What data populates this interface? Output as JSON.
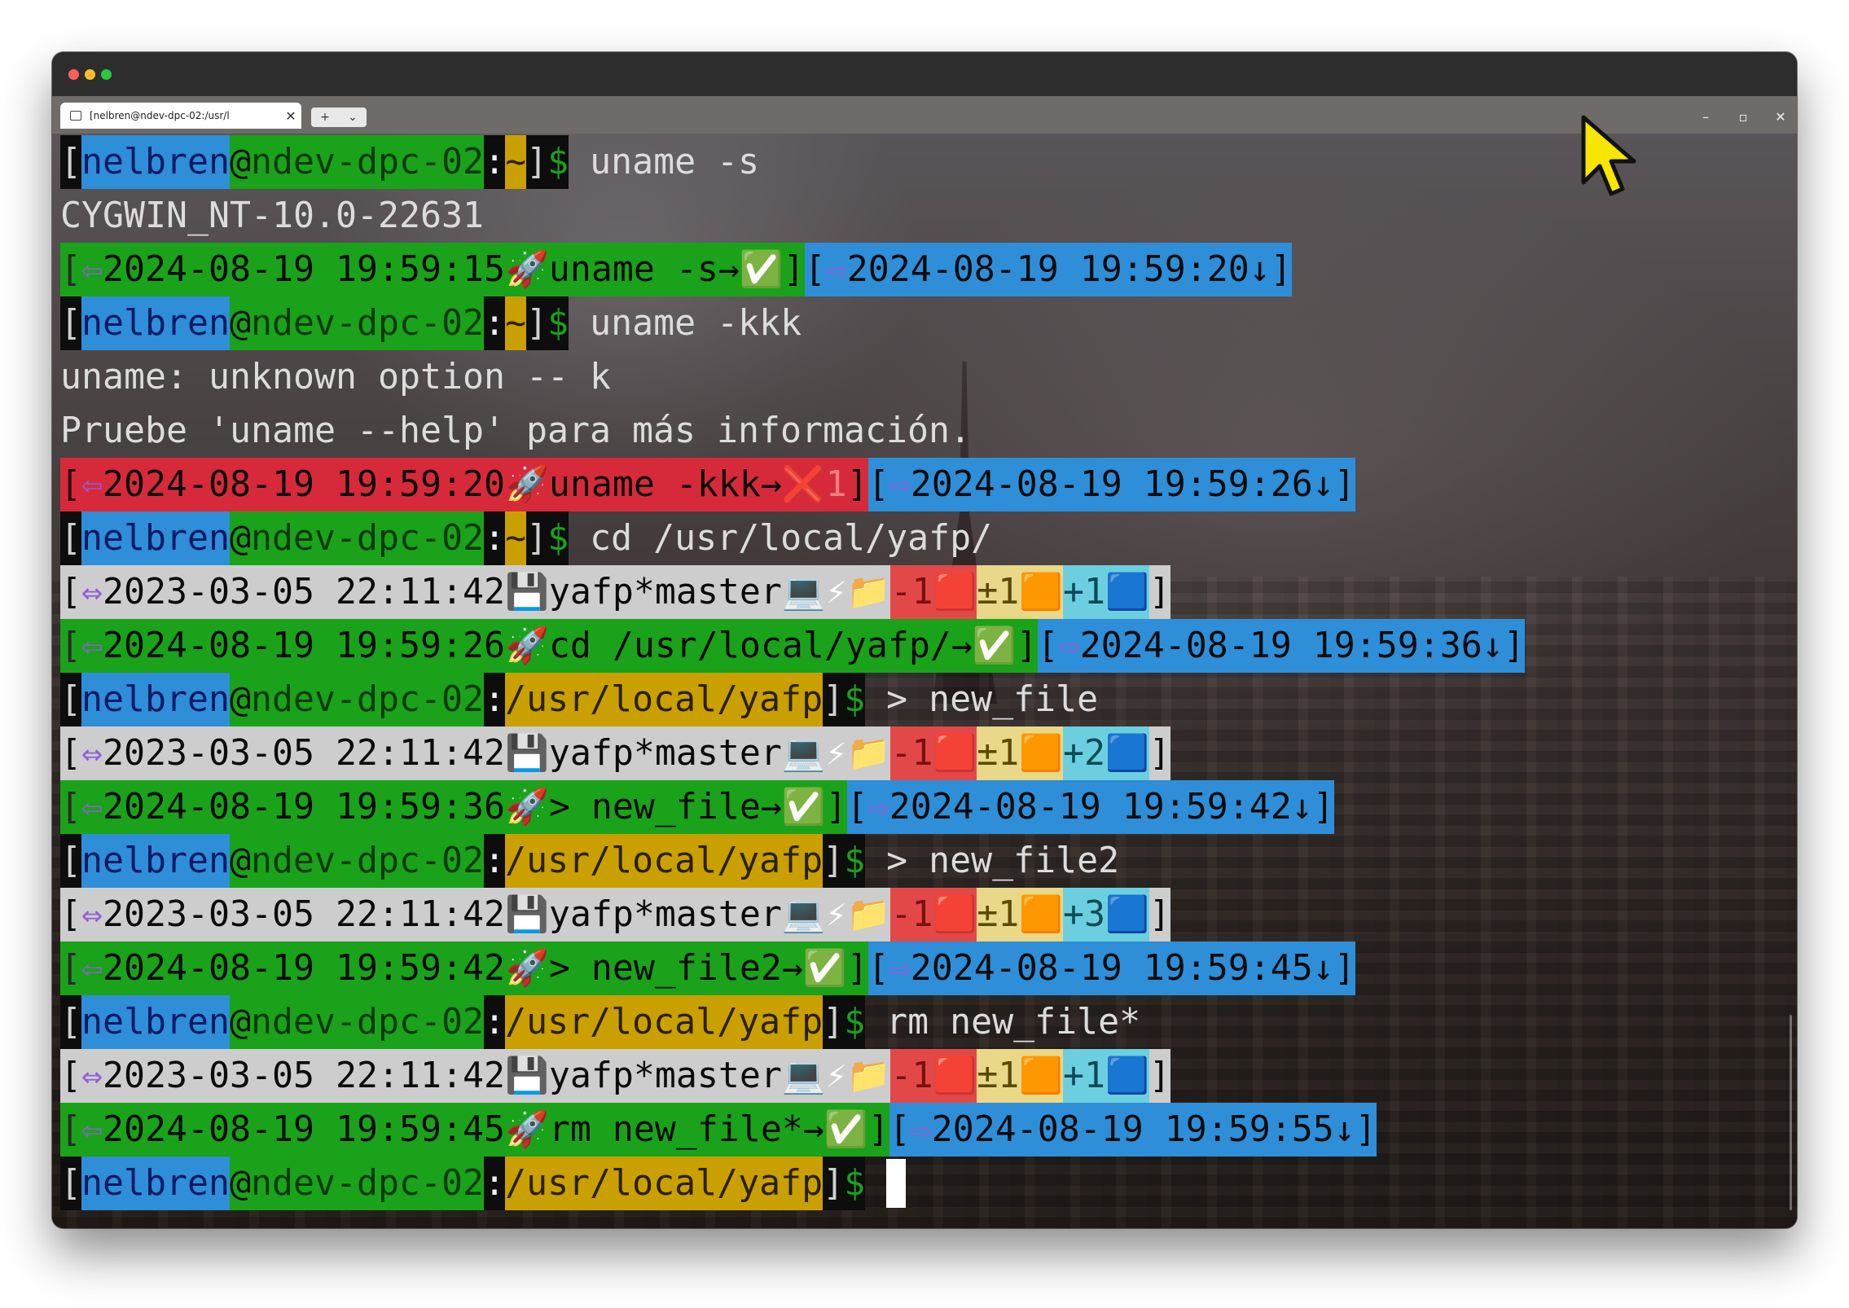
{
  "window": {
    "tab_title": "[nelbren@ndev-dpc-02:/usr/l",
    "tab_close": "✕",
    "new_tab": "+",
    "tab_menu": "⌄",
    "minimize": "–",
    "maximize": "▫",
    "close": "✕",
    "traffic_lights": [
      "#ff5f57",
      "#febc2e",
      "#28c840"
    ]
  },
  "colors": {
    "blue": "#2e8ed8",
    "green": "#1aa21a",
    "black": "#0d0d0d",
    "gold": "#c9a000",
    "red": "#d62a3a",
    "gray": "#cdcdcd",
    "sky": "#3a98dc",
    "yellow": "#e8d888",
    "cyan": "#6ccfe0",
    "lime": "#7dd87d",
    "lightred": "#e34848",
    "orange": "#f6a52c"
  },
  "terminal": {
    "lines": [
      {
        "segments": [
          [
            "[",
            "black",
            "#d0d0d0"
          ],
          [
            "nelbren",
            "blue",
            "#0e1a66"
          ],
          [
            "@",
            "green",
            "#101010"
          ],
          [
            "ndev-dpc-02",
            "green",
            "#0c3a0c"
          ],
          [
            ":",
            "black",
            "#f0f0f0"
          ],
          [
            "~",
            "gold",
            "#2a2000"
          ],
          [
            "]",
            "black",
            "#d0d0d0"
          ],
          [
            "$",
            "black",
            "#1ca01c"
          ],
          [
            " uname -s",
            "none",
            "#dcdcdc"
          ]
        ]
      },
      {
        "segments": [
          [
            "CYGWIN_NT-10.0-22631",
            "none",
            "#dcdcdc"
          ]
        ]
      },
      {
        "segments": [
          [
            "[",
            "green",
            "#2a2a2a"
          ],
          [
            "⇦",
            "green",
            "#8f5fd8"
          ],
          [
            "2024-08-19 19:59:15",
            "green",
            "#0b0b0b"
          ],
          [
            "🚀",
            "green",
            "#ffffff"
          ],
          [
            "uname -s→",
            "green",
            "#0b0b0b"
          ],
          [
            "✅",
            "green",
            "#ffffff"
          ],
          [
            "]",
            "green",
            "#0b0b0b"
          ],
          [
            "[",
            "blue",
            "#0b0b0b"
          ],
          [
            "⇨",
            "blue",
            "#8f5fd8"
          ],
          [
            "2024-08-19 19:59:20↓",
            "blue",
            "#0b0b0b"
          ],
          [
            "]",
            "blue",
            "#0b0b0b"
          ]
        ]
      },
      {
        "segments": [
          [
            "[",
            "black",
            "#d0d0d0"
          ],
          [
            "nelbren",
            "blue",
            "#0e1a66"
          ],
          [
            "@",
            "green",
            "#101010"
          ],
          [
            "ndev-dpc-02",
            "green",
            "#0c3a0c"
          ],
          [
            ":",
            "black",
            "#f0f0f0"
          ],
          [
            "~",
            "gold",
            "#2a2000"
          ],
          [
            "]",
            "black",
            "#d0d0d0"
          ],
          [
            "$",
            "black",
            "#1ca01c"
          ],
          [
            " uname -kkk",
            "none",
            "#dcdcdc"
          ]
        ]
      },
      {
        "segments": [
          [
            "uname: unknown option -- k",
            "none",
            "#dcdcdc"
          ]
        ]
      },
      {
        "segments": [
          [
            "Pruebe 'uname --help' para más información.",
            "none",
            "#dcdcdc"
          ]
        ]
      },
      {
        "segments": [
          [
            "[",
            "red",
            "#2a0a0a"
          ],
          [
            "⇦",
            "red",
            "#8f5fd8"
          ],
          [
            "2024-08-19 19:59:20",
            "red",
            "#0b0b0b"
          ],
          [
            "🚀",
            "red",
            "#ffffff"
          ],
          [
            "uname -kkk→",
            "red",
            "#0b0b0b"
          ],
          [
            "❌",
            "red",
            "#ffffff"
          ],
          [
            "1",
            "red",
            "#f08080"
          ],
          [
            "]",
            "red",
            "#0b0b0b"
          ],
          [
            "[",
            "blue",
            "#0b0b0b"
          ],
          [
            "⇨",
            "blue",
            "#8f5fd8"
          ],
          [
            "2024-08-19 19:59:26↓",
            "blue",
            "#0b0b0b"
          ],
          [
            "]",
            "blue",
            "#0b0b0b"
          ]
        ]
      },
      {
        "segments": [
          [
            "[",
            "black",
            "#d0d0d0"
          ],
          [
            "nelbren",
            "blue",
            "#0e1a66"
          ],
          [
            "@",
            "green",
            "#101010"
          ],
          [
            "ndev-dpc-02",
            "green",
            "#0c3a0c"
          ],
          [
            ":",
            "black",
            "#f0f0f0"
          ],
          [
            "~",
            "gold",
            "#2a2000"
          ],
          [
            "]",
            "black",
            "#d0d0d0"
          ],
          [
            "$",
            "black",
            "#1ca01c"
          ],
          [
            " cd /usr/local/yafp/",
            "none",
            "#dcdcdc"
          ]
        ]
      },
      {
        "segments": [
          [
            "[",
            "gray",
            "#0b0b0b"
          ],
          [
            "⇔",
            "gray",
            "#8f5fd8"
          ],
          [
            "2023-03-05 22:11:42",
            "gray",
            "#0b0b0b"
          ],
          [
            "💾",
            "gray",
            "#ffffff"
          ],
          [
            "yafp*master",
            "gray",
            "#0b0b0b"
          ],
          [
            "💻",
            "gray",
            "#ffffff"
          ],
          [
            "⚡",
            "gray",
            "#ffffff"
          ],
          [
            "📁",
            "gray",
            "#ffffff"
          ],
          [
            "-1",
            "lightred",
            "#7a1010"
          ],
          [
            "🟥",
            "lightred",
            "#ffffff"
          ],
          [
            "±1",
            "yellow",
            "#5a4a00"
          ],
          [
            "🟧",
            "yellow",
            "#ffffff"
          ],
          [
            "+1",
            "cyan",
            "#0a4a55"
          ],
          [
            "🟦",
            "cyan",
            "#ffffff"
          ],
          [
            "]",
            "gray",
            "#0b0b0b"
          ]
        ]
      },
      {
        "segments": [
          [
            "[",
            "green",
            "#2a2a2a"
          ],
          [
            "⇦",
            "green",
            "#8f5fd8"
          ],
          [
            "2024-08-19 19:59:26",
            "green",
            "#0b0b0b"
          ],
          [
            "🚀",
            "green",
            "#ffffff"
          ],
          [
            "cd /usr/local/yafp/→",
            "green",
            "#0b0b0b"
          ],
          [
            "✅",
            "green",
            "#ffffff"
          ],
          [
            "]",
            "green",
            "#0b0b0b"
          ],
          [
            "[",
            "blue",
            "#0b0b0b"
          ],
          [
            "⇨",
            "blue",
            "#8f5fd8"
          ],
          [
            "2024-08-19 19:59:36↓",
            "blue",
            "#0b0b0b"
          ],
          [
            "]",
            "blue",
            "#0b0b0b"
          ]
        ]
      },
      {
        "segments": [
          [
            "[",
            "black",
            "#d0d0d0"
          ],
          [
            "nelbren",
            "blue",
            "#0e1a66"
          ],
          [
            "@",
            "green",
            "#101010"
          ],
          [
            "ndev-dpc-02",
            "green",
            "#0c3a0c"
          ],
          [
            ":",
            "black",
            "#f0f0f0"
          ],
          [
            "/usr/local/yafp",
            "gold",
            "#2a2000"
          ],
          [
            "]",
            "black",
            "#d0d0d0"
          ],
          [
            "$",
            "black",
            "#1ca01c"
          ],
          [
            " > new_file",
            "none",
            "#dcdcdc"
          ]
        ]
      },
      {
        "segments": [
          [
            "[",
            "gray",
            "#0b0b0b"
          ],
          [
            "⇔",
            "gray",
            "#8f5fd8"
          ],
          [
            "2023-03-05 22:11:42",
            "gray",
            "#0b0b0b"
          ],
          [
            "💾",
            "gray",
            "#ffffff"
          ],
          [
            "yafp*master",
            "gray",
            "#0b0b0b"
          ],
          [
            "💻",
            "gray",
            "#ffffff"
          ],
          [
            "⚡",
            "gray",
            "#ffffff"
          ],
          [
            "📁",
            "gray",
            "#ffffff"
          ],
          [
            "-1",
            "lightred",
            "#7a1010"
          ],
          [
            "🟥",
            "lightred",
            "#ffffff"
          ],
          [
            "±1",
            "yellow",
            "#5a4a00"
          ],
          [
            "🟧",
            "yellow",
            "#ffffff"
          ],
          [
            "+2",
            "cyan",
            "#0a4a55"
          ],
          [
            "🟦",
            "cyan",
            "#ffffff"
          ],
          [
            "]",
            "gray",
            "#0b0b0b"
          ]
        ]
      },
      {
        "segments": [
          [
            "[",
            "green",
            "#2a2a2a"
          ],
          [
            "⇦",
            "green",
            "#8f5fd8"
          ],
          [
            "2024-08-19 19:59:36",
            "green",
            "#0b0b0b"
          ],
          [
            "🚀",
            "green",
            "#ffffff"
          ],
          [
            "> new_file→",
            "green",
            "#0b0b0b"
          ],
          [
            "✅",
            "green",
            "#ffffff"
          ],
          [
            "]",
            "green",
            "#0b0b0b"
          ],
          [
            "[",
            "blue",
            "#0b0b0b"
          ],
          [
            "⇨",
            "blue",
            "#8f5fd8"
          ],
          [
            "2024-08-19 19:59:42↓",
            "blue",
            "#0b0b0b"
          ],
          [
            "]",
            "blue",
            "#0b0b0b"
          ]
        ]
      },
      {
        "segments": [
          [
            "[",
            "black",
            "#d0d0d0"
          ],
          [
            "nelbren",
            "blue",
            "#0e1a66"
          ],
          [
            "@",
            "green",
            "#101010"
          ],
          [
            "ndev-dpc-02",
            "green",
            "#0c3a0c"
          ],
          [
            ":",
            "black",
            "#f0f0f0"
          ],
          [
            "/usr/local/yafp",
            "gold",
            "#2a2000"
          ],
          [
            "]",
            "black",
            "#d0d0d0"
          ],
          [
            "$",
            "black",
            "#1ca01c"
          ],
          [
            " > new_file2",
            "none",
            "#dcdcdc"
          ]
        ]
      },
      {
        "segments": [
          [
            "[",
            "gray",
            "#0b0b0b"
          ],
          [
            "⇔",
            "gray",
            "#8f5fd8"
          ],
          [
            "2023-03-05 22:11:42",
            "gray",
            "#0b0b0b"
          ],
          [
            "💾",
            "gray",
            "#ffffff"
          ],
          [
            "yafp*master",
            "gray",
            "#0b0b0b"
          ],
          [
            "💻",
            "gray",
            "#ffffff"
          ],
          [
            "⚡",
            "gray",
            "#ffffff"
          ],
          [
            "📁",
            "gray",
            "#ffffff"
          ],
          [
            "-1",
            "lightred",
            "#7a1010"
          ],
          [
            "🟥",
            "lightred",
            "#ffffff"
          ],
          [
            "±1",
            "yellow",
            "#5a4a00"
          ],
          [
            "🟧",
            "yellow",
            "#ffffff"
          ],
          [
            "+3",
            "cyan",
            "#0a4a55"
          ],
          [
            "🟦",
            "cyan",
            "#ffffff"
          ],
          [
            "]",
            "gray",
            "#0b0b0b"
          ]
        ]
      },
      {
        "segments": [
          [
            "[",
            "green",
            "#2a2a2a"
          ],
          [
            "⇦",
            "green",
            "#8f5fd8"
          ],
          [
            "2024-08-19 19:59:42",
            "green",
            "#0b0b0b"
          ],
          [
            "🚀",
            "green",
            "#ffffff"
          ],
          [
            "> new_file2→",
            "green",
            "#0b0b0b"
          ],
          [
            "✅",
            "green",
            "#ffffff"
          ],
          [
            "]",
            "green",
            "#0b0b0b"
          ],
          [
            "[",
            "blue",
            "#0b0b0b"
          ],
          [
            "⇨",
            "blue",
            "#8f5fd8"
          ],
          [
            "2024-08-19 19:59:45↓",
            "blue",
            "#0b0b0b"
          ],
          [
            "]",
            "blue",
            "#0b0b0b"
          ]
        ]
      },
      {
        "segments": [
          [
            "[",
            "black",
            "#d0d0d0"
          ],
          [
            "nelbren",
            "blue",
            "#0e1a66"
          ],
          [
            "@",
            "green",
            "#101010"
          ],
          [
            "ndev-dpc-02",
            "green",
            "#0c3a0c"
          ],
          [
            ":",
            "black",
            "#f0f0f0"
          ],
          [
            "/usr/local/yafp",
            "gold",
            "#2a2000"
          ],
          [
            "]",
            "black",
            "#d0d0d0"
          ],
          [
            "$",
            "black",
            "#1ca01c"
          ],
          [
            " rm new_file*",
            "none",
            "#dcdcdc"
          ]
        ]
      },
      {
        "segments": [
          [
            "[",
            "gray",
            "#0b0b0b"
          ],
          [
            "⇔",
            "gray",
            "#8f5fd8"
          ],
          [
            "2023-03-05 22:11:42",
            "gray",
            "#0b0b0b"
          ],
          [
            "💾",
            "gray",
            "#ffffff"
          ],
          [
            "yafp*master",
            "gray",
            "#0b0b0b"
          ],
          [
            "💻",
            "gray",
            "#ffffff"
          ],
          [
            "⚡",
            "gray",
            "#ffffff"
          ],
          [
            "📁",
            "gray",
            "#ffffff"
          ],
          [
            "-1",
            "lightred",
            "#7a1010"
          ],
          [
            "🟥",
            "lightred",
            "#ffffff"
          ],
          [
            "±1",
            "yellow",
            "#5a4a00"
          ],
          [
            "🟧",
            "yellow",
            "#ffffff"
          ],
          [
            "+1",
            "cyan",
            "#0a4a55"
          ],
          [
            "🟦",
            "cyan",
            "#ffffff"
          ],
          [
            "]",
            "gray",
            "#0b0b0b"
          ]
        ]
      },
      {
        "segments": [
          [
            "[",
            "green",
            "#2a2a2a"
          ],
          [
            "⇦",
            "green",
            "#8f5fd8"
          ],
          [
            "2024-08-19 19:59:45",
            "green",
            "#0b0b0b"
          ],
          [
            "🚀",
            "green",
            "#ffffff"
          ],
          [
            "rm new_file*→",
            "green",
            "#0b0b0b"
          ],
          [
            "✅",
            "green",
            "#ffffff"
          ],
          [
            "]",
            "green",
            "#0b0b0b"
          ],
          [
            "[",
            "blue",
            "#0b0b0b"
          ],
          [
            "⇨",
            "blue",
            "#8f5fd8"
          ],
          [
            "2024-08-19 19:59:55↓",
            "blue",
            "#0b0b0b"
          ],
          [
            "]",
            "blue",
            "#0b0b0b"
          ]
        ]
      },
      {
        "segments": [
          [
            "[",
            "black",
            "#d0d0d0"
          ],
          [
            "nelbren",
            "blue",
            "#0e1a66"
          ],
          [
            "@",
            "green",
            "#101010"
          ],
          [
            "ndev-dpc-02",
            "green",
            "#0c3a0c"
          ],
          [
            ":",
            "black",
            "#f0f0f0"
          ],
          [
            "/usr/local/yafp",
            "gold",
            "#2a2000"
          ],
          [
            "]",
            "black",
            "#d0d0d0"
          ],
          [
            "$",
            "black",
            "#1ca01c"
          ],
          [
            " ",
            "none",
            "#dcdcdc"
          ]
        ],
        "cursor": true
      }
    ]
  }
}
